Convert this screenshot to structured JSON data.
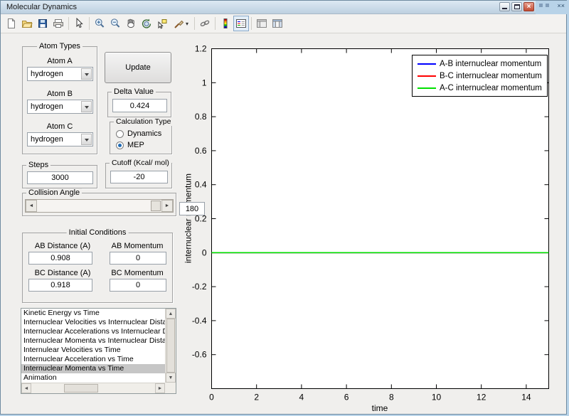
{
  "window": {
    "title": "Molecular Dynamics"
  },
  "window_buttons": [
    "minimize",
    "maximize",
    "close"
  ],
  "toolbar": {
    "icons": [
      "new-figure",
      "open-file",
      "save-figure",
      "print-figure",
      "edit-plot",
      "zoom-in",
      "zoom-out",
      "pan",
      "rotate-3d",
      "data-cursor",
      "brush-data",
      "link-plot",
      "insert-colorbar",
      "insert-legend",
      "hide-plot-tools",
      "show-plot-tools"
    ],
    "active_icon": "insert-legend"
  },
  "controls": {
    "atom_types": {
      "title": "Atom Types",
      "dropdowns": [
        {
          "label": "Atom A",
          "value": "hydrogen"
        },
        {
          "label": "Atom B",
          "value": "hydrogen"
        },
        {
          "label": "Atom C",
          "value": "hydrogen"
        }
      ]
    },
    "update_button_label": "Update",
    "delta_value": {
      "title": "Delta Value",
      "value": "0.424"
    },
    "calculation_type": {
      "title": "Calculation Type",
      "options": [
        {
          "label": "Dynamics",
          "selected": false
        },
        {
          "label": "MEP",
          "selected": true
        }
      ]
    },
    "steps": {
      "title": "Steps",
      "value": "3000"
    },
    "cutoff": {
      "title": "Cutoff (Kcal/ mol)",
      "value": "-20"
    },
    "collision_angle": {
      "title": "Collision Angle",
      "value": "180"
    },
    "initial_conditions": {
      "title": "Initial Conditions",
      "fields": [
        {
          "label": "AB Distance (A)",
          "value": "0.908"
        },
        {
          "label": "AB Momentum",
          "value": "0"
        },
        {
          "label": "BC Distance (A)",
          "value": "0.918"
        },
        {
          "label": "BC Momentum",
          "value": "0"
        }
      ]
    },
    "plot_list": {
      "items": [
        "Kinetic Energy vs Time",
        "Internuclear Velocities vs Internuclear Distance",
        "Internuclear Accelerations vs Internuclear Distance",
        "Internuclear Momenta vs Internuclear Distance",
        "Internulear Velocities vs Time",
        "Internuclear Acceleration vs Time",
        "Internuclear Momenta vs Time",
        "Animation"
      ],
      "selected_index": 6
    }
  },
  "chart_data": {
    "type": "line",
    "title": "",
    "xlabel": "time",
    "ylabel": "internuclear momentum",
    "xlim": [
      0,
      15
    ],
    "ylim": [
      -0.8,
      1.2
    ],
    "xticks": [
      0,
      2,
      4,
      6,
      8,
      10,
      12,
      14
    ],
    "yticks": [
      1.2,
      1,
      0.8,
      0.6,
      0.4,
      0.2,
      0,
      -0.2,
      -0.4,
      -0.6
    ],
    "grid": false,
    "legend_position": "top-right",
    "series": [
      {
        "name": "A-B internuclear momentum",
        "color": "#0000ff",
        "x": [
          0,
          15
        ],
        "y": [
          0,
          0
        ]
      },
      {
        "name": "B-C internuclear momentum",
        "color": "#ff0000",
        "x": [
          0,
          15
        ],
        "y": [
          0,
          0
        ]
      },
      {
        "name": "A-C internuclear momentum",
        "color": "#00e000",
        "x": [
          0,
          15
        ],
        "y": [
          0,
          0
        ]
      }
    ]
  },
  "colors": {
    "desktop": "#b8d3e8",
    "figure_bg": "#f0efed",
    "titlebar_top": "#dde9f3",
    "titlebar_bottom": "#bdd0e0",
    "selection_bg": "#c6c6c6"
  }
}
